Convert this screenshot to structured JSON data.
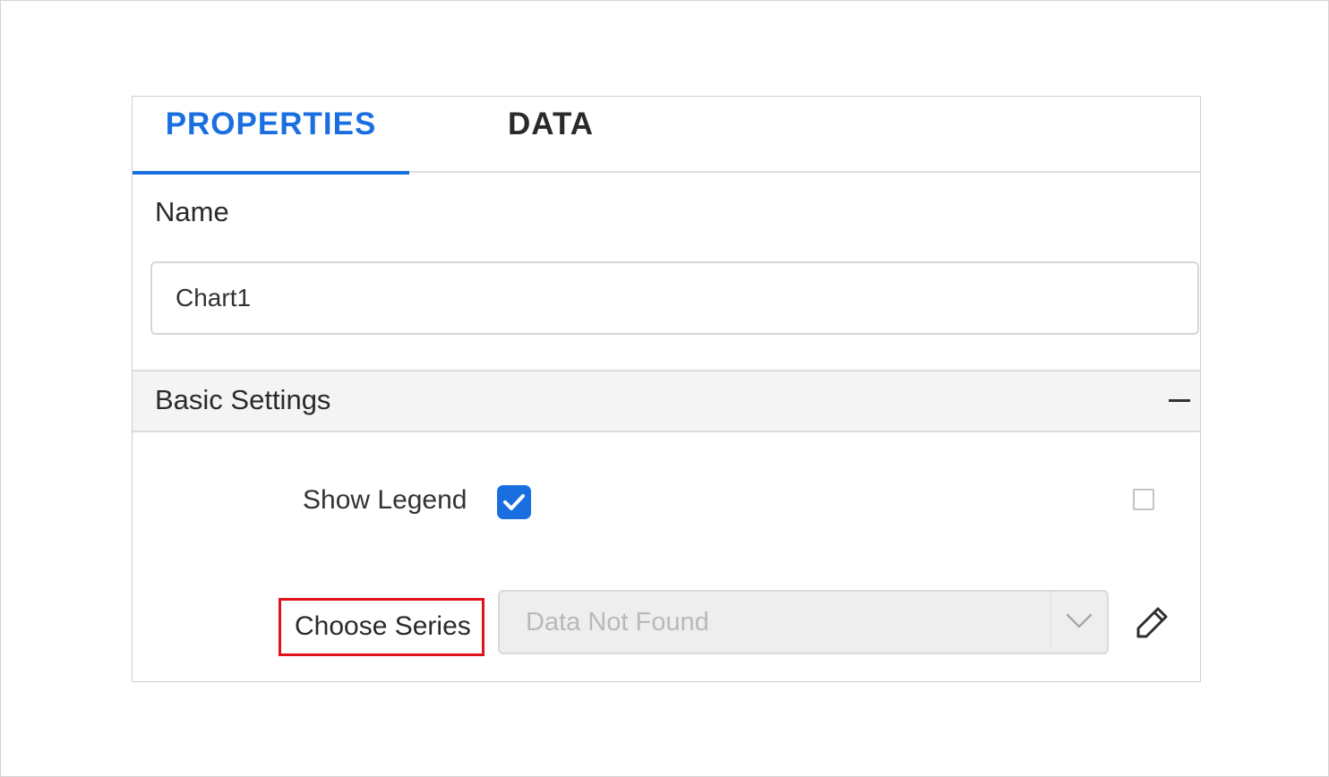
{
  "tabs": [
    {
      "label": "PROPERTIES",
      "active": true
    },
    {
      "label": "DATA",
      "active": false
    }
  ],
  "name_section": {
    "label": "Name",
    "value": "Chart1"
  },
  "basic_settings": {
    "title": "Basic Settings",
    "collapse_icon": "minus-icon",
    "show_legend": {
      "label": "Show Legend",
      "checked": true
    },
    "extra_checkbox": {
      "checked": false
    },
    "choose_series": {
      "label": "Choose Series",
      "placeholder": "Data Not Found",
      "disabled": true,
      "highlight_color": "#e0121c"
    },
    "edit_icon": "pencil-icon"
  },
  "colors": {
    "accent": "#1a6fe0",
    "highlight": "#e0121c"
  }
}
